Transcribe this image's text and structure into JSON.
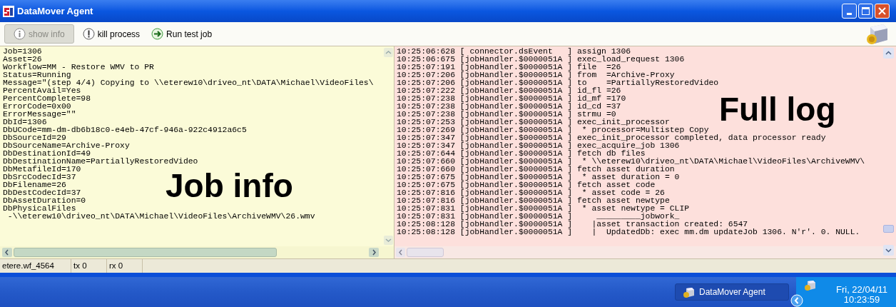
{
  "window": {
    "title": "DataMover Agent"
  },
  "toolbar": [
    {
      "kind": "info",
      "label": "show info",
      "disabled": true
    },
    {
      "kind": "warning",
      "label": "kill process",
      "disabled": false
    },
    {
      "kind": "run",
      "label": "Run test job",
      "disabled": false
    }
  ],
  "job_info": {
    "overlay": "Job info",
    "lines": [
      "Job=1306",
      "Asset=26",
      "Workflow=MM - Restore WMV to PR",
      "Status=Running",
      "Message=\"(step 4/4) Copying to \\\\eterew10\\driveo_nt\\DATA\\Michael\\VideoFiles\\",
      "PercentAvail=Yes",
      "PercentComplete=98",
      "ErrorCode=0x00",
      "ErrorMessage=\"\"",
      "DbId=1306",
      "DbUCode=mm-dm-db6b18c0-e4eb-47cf-946a-922c4912a6c5",
      "DbSourceId=29",
      "DbSourceName=Archive-Proxy",
      "DbDestinationId=49",
      "DbDestinationName=PartiallyRestoredVideo",
      "DbMetafileId=170",
      "DbSrcCodecId=37",
      "DbFilename=26",
      "DbDestCodecId=37",
      "DbAssetDuration=0",
      "DbPhysicalFiles",
      " -\\\\eterew10\\driveo_nt\\DATA\\Michael\\VideoFiles\\ArchiveWMV\\26.wmv"
    ]
  },
  "full_log": {
    "overlay": "Full log",
    "lines": [
      "10:25:06:628 [ connector.dsEvent   ] assign 1306",
      "10:25:06:675 [jobHandler.$0000051A ] exec_load_request 1306",
      "10:25:07:191 [jobHandler.$0000051A ] file  =26",
      "10:25:07:206 [jobHandler.$0000051A ] from  =Archive-Proxy",
      "10:25:07:206 [jobHandler.$0000051A ] to    =PartiallyRestoredVideo",
      "10:25:07:222 [jobHandler.$0000051A ] id_fl =26",
      "10:25:07:238 [jobHandler.$0000051A ] id_mf =170",
      "10:25:07:238 [jobHandler.$0000051A ] id_cd =37",
      "10:25:07:238 [jobHandler.$0000051A ] strmu =0",
      "10:25:07:253 [jobHandler.$0000051A ] exec_init_processor",
      "10:25:07:269 [jobHandler.$0000051A ]  * processor=Multistep Copy",
      "10:25:07:347 [jobHandler.$0000051A ] exec_init_processor completed, data processor ready",
      "10:25:07:347 [jobHandler.$0000051A ] exec_acquire_job 1306",
      "10:25:07:644 [jobHandler.$0000051A ] fetch db files",
      "10:25:07:660 [jobHandler.$0000051A ]  * \\\\eterew10\\driveo_nt\\DATA\\Michael\\VideoFiles\\ArchiveWMV\\",
      "10:25:07:660 [jobHandler.$0000051A ] fetch asset duration",
      "10:25:07:675 [jobHandler.$0000051A ]  * asset duration = 0",
      "10:25:07:675 [jobHandler.$0000051A ] fetch asset code",
      "10:25:07:816 [jobHandler.$0000051A ]  * asset code = 26",
      "10:25:07:816 [jobHandler.$0000051A ] fetch asset newtype",
      "10:25:07:831 [jobHandler.$0000051A ]  * asset newtype = CLIP",
      "10:25:07:831 [jobHandler.$0000051A ]     _________jobwork_",
      "10:25:08:128 [jobHandler.$0000051A ]    |asset transaction created: 6547",
      "10:25:08:128 [jobHandler.$0000051A ]    |  UpdatedDb: exec mm.dm updateJob 1306. N'r'. 0. NULL."
    ]
  },
  "status_bar": [
    "etere.wf_4564",
    "tx 0",
    "rx 0"
  ],
  "taskbar": {
    "task": "DataMover Agent",
    "date": "Fri, 22/04/11",
    "time": "10:23:59"
  }
}
